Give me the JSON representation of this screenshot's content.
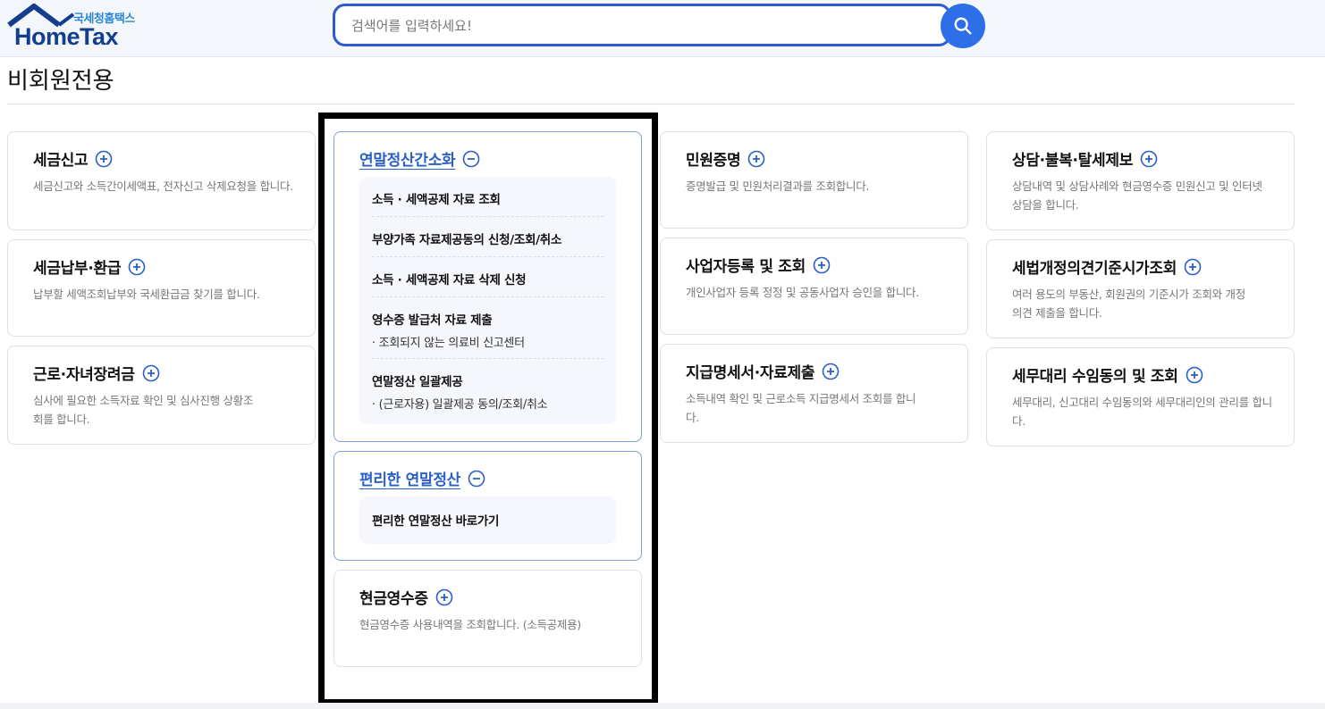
{
  "header": {
    "logo_small": "국세청홈택스",
    "logo_big": "HomeTax",
    "search_placeholder": "검색어를 입력하세요!"
  },
  "page": {
    "title": "비회원전용"
  },
  "colors": {
    "accent": "#2c6fe8",
    "brand_navy": "#123e8c",
    "link_blue": "#2a5fc6",
    "highlight": "#000000"
  },
  "cards": {
    "tax_filing": {
      "title": "세금신고",
      "desc": "세금신고와 소득간이세액표, 전자신고 삭제요청을 합니다."
    },
    "tax_payment": {
      "title": "세금납부·환급",
      "desc": "납부할 세액조회납부와 국세환급금 찾기를 합니다."
    },
    "earned_credit": {
      "title": "근로·자녀장려금",
      "desc": "심사에 필요한 소득자료 확인 및 심사진행 상황조회를 합니다."
    },
    "year_end_simple": {
      "title": "연말정산간소화",
      "items": [
        {
          "title": "소득 · 세액공제 자료 조회",
          "sub": ""
        },
        {
          "title": "부양가족 자료제공동의 신청/조회/취소",
          "sub": ""
        },
        {
          "title": "소득 · 세액공제 자료 삭제 신청",
          "sub": ""
        },
        {
          "title": "영수증 발급처 자료 제출",
          "sub": "· 조회되지 않는 의료비 신고센터"
        },
        {
          "title": "연말정산 일괄제공",
          "sub": "· (근로자용) 일괄제공 동의/조회/취소"
        }
      ]
    },
    "easy_year_end": {
      "title": "편리한 연말정산",
      "items": [
        {
          "title": "편리한 연말정산 바로가기"
        }
      ]
    },
    "cash_receipt": {
      "title": "현금영수증",
      "desc": "현금영수증 사용내역을 조회합니다. (소득공제용)"
    },
    "civil_cert": {
      "title": "민원증명",
      "desc": "증명발급 및 민원처리결과를 조회합니다."
    },
    "business_reg": {
      "title": "사업자등록 및 조회",
      "desc": "개인사업자 등록 정정 및 공동사업자 승인을 합니다."
    },
    "payment_statement": {
      "title": "지급명세서·자료제출",
      "desc": "소득내역 확인 및 근로소득 지급명세서 조회를 합니다."
    },
    "consulting": {
      "title": "상담·불복·탈세제보",
      "desc": "상담내역 및 상담사례와 현금영수증 민원신고 및 인터넷 상담을 합니다."
    },
    "tax_law_opinion": {
      "title": "세법개정의견기준시가조회",
      "desc": "여러 용도의 부동산, 회원권의 기준시가 조회와 개정의견 제출을 합니다."
    },
    "tax_agent": {
      "title": "세무대리 수임동의 및 조회",
      "desc": "세무대리, 신고대리 수임동의와 세무대리인의 관리를 합니다."
    }
  }
}
